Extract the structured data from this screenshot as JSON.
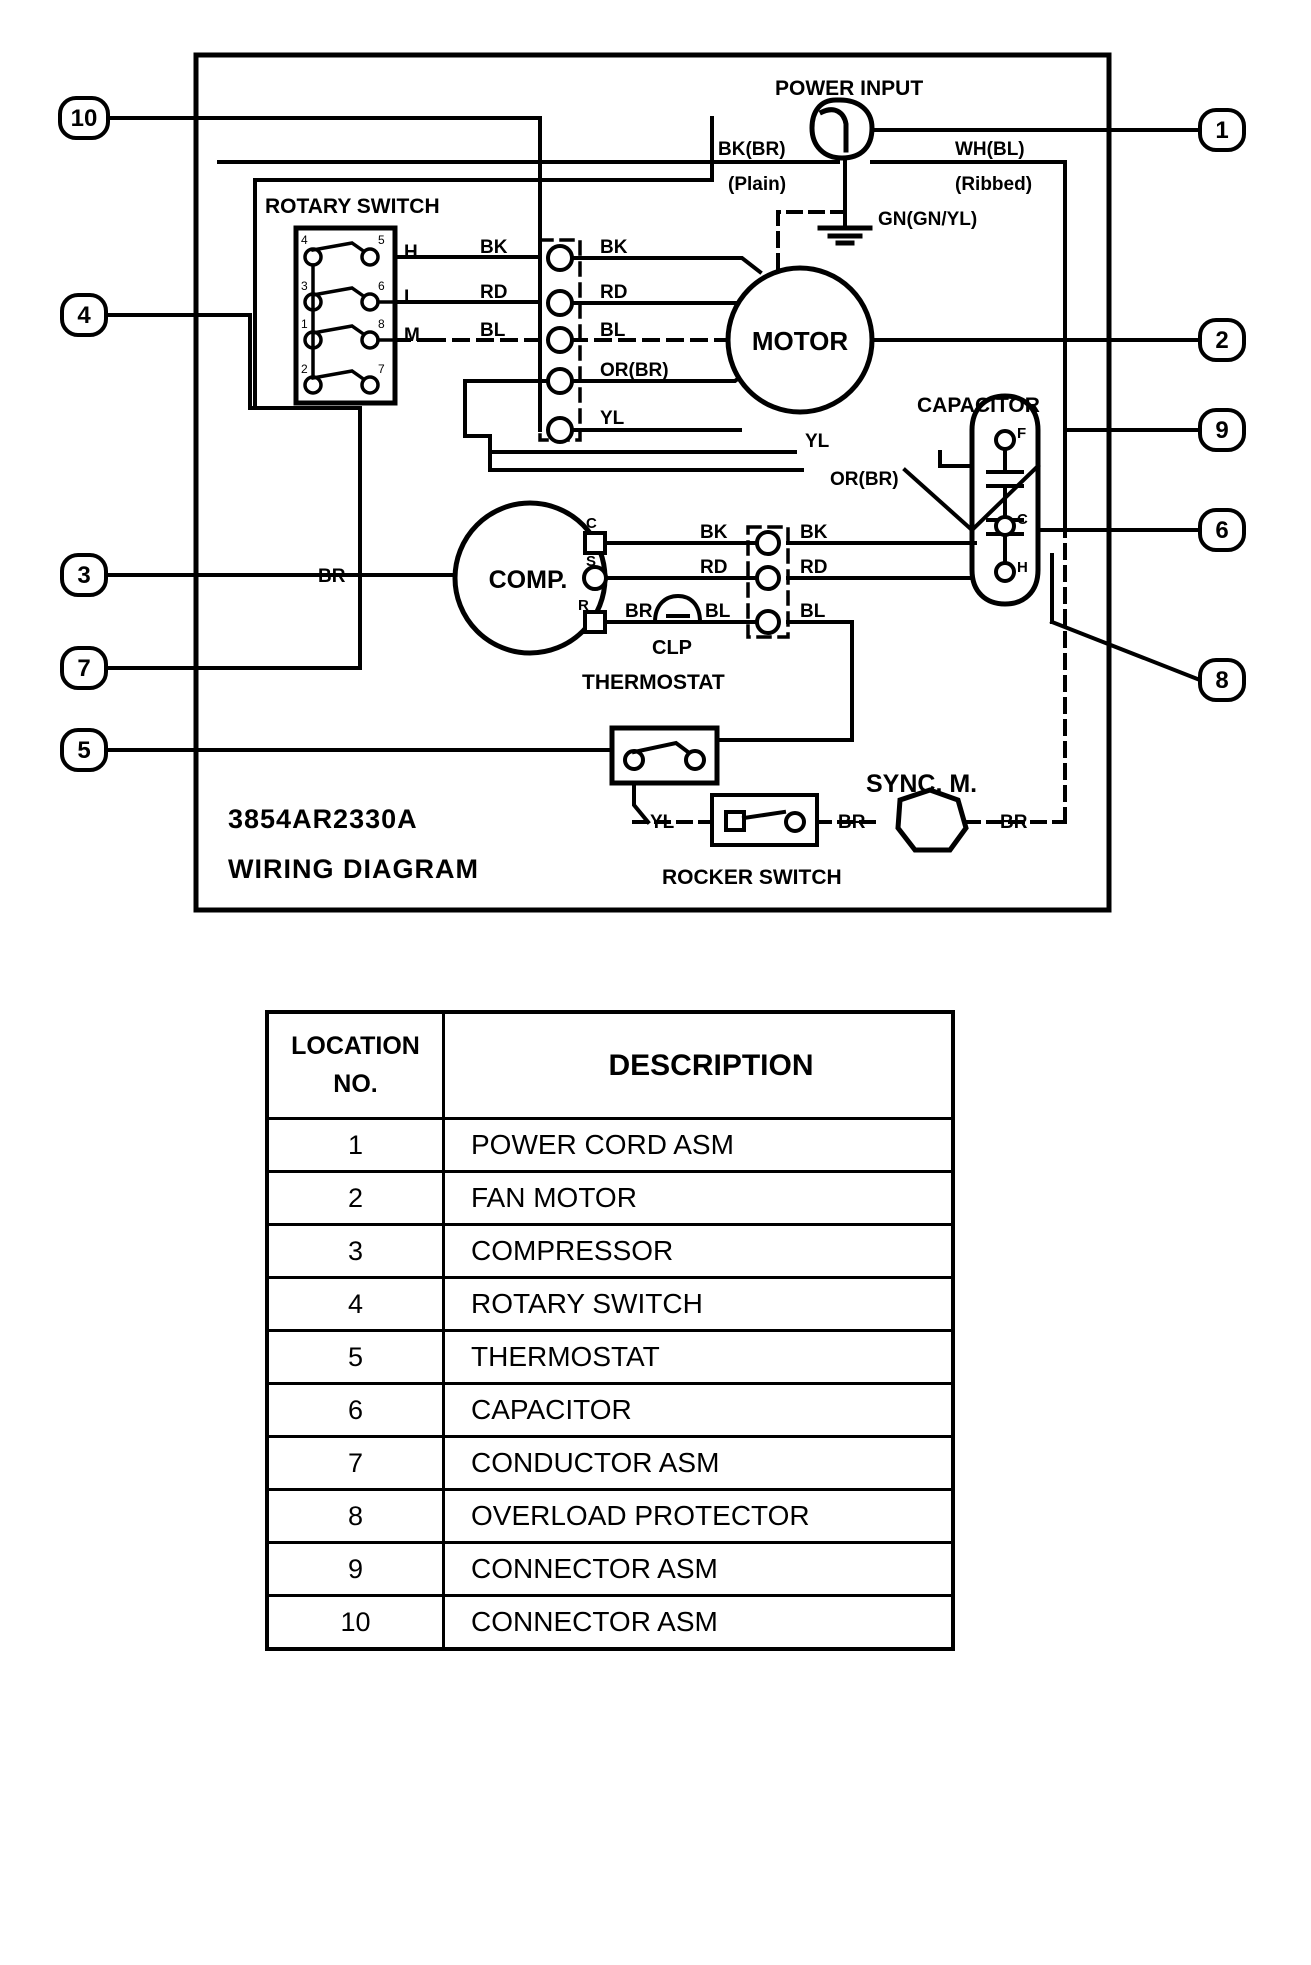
{
  "diagram": {
    "title_lines": [
      "3854AR2330A",
      "WIRING DIAGRAM"
    ],
    "blocks": {
      "power_input": "POWER INPUT",
      "rotary_switch": "ROTARY SWITCH",
      "motor": "MOTOR",
      "comp": "COMP.",
      "capacitor": "CAPACITOR",
      "thermostat": "THERMOSTAT",
      "rocker_switch": "ROCKER SWITCH",
      "sync_motor": "SYNC. M.",
      "clp": "CLP"
    },
    "wire_labels": {
      "line_bk": "BK(BR)",
      "line_bk_sub": "(Plain)",
      "line_wh": "WH(BL)",
      "line_wh_sub": "(Ribbed)",
      "ground": "GN(GN/YL)",
      "sw_h": "H",
      "sw_l": "L",
      "sw_m": "M",
      "sw_bk": "BK",
      "sw_rd": "RD",
      "sw_bl": "BL",
      "conn_bk": "BK",
      "conn_rd": "RD",
      "conn_bl": "BL",
      "conn_or": "OR(BR)",
      "conn_yl": "YL",
      "cap_yl": "YL",
      "cap_or": "OR(BR)",
      "comp_bk": "BK",
      "comp_rd": "RD",
      "comp_br": "BR",
      "comp_bl": "BL",
      "comp_bk2": "BK",
      "comp_rd2": "RD",
      "comp_bl2": "BL",
      "br_left": "BR",
      "thermo_yl": "YL",
      "sync_br_left": "BR",
      "sync_br_right": "BR",
      "comp_c": "C",
      "comp_s": "S",
      "comp_r": "R",
      "cap_f": "F",
      "cap_c": "C",
      "cap_h": "H"
    },
    "callouts": [
      "10",
      "1",
      "4",
      "2",
      "9",
      "3",
      "6",
      "7",
      "8",
      "5"
    ],
    "switch_contacts": [
      "4",
      "5",
      "3",
      "6",
      "1",
      "8",
      "2",
      "7"
    ]
  },
  "legend": {
    "headers": {
      "col1_line1": "LOCATION",
      "col1_line2": "NO.",
      "col2": "DESCRIPTION"
    },
    "rows": [
      {
        "no": "1",
        "description": "POWER CORD ASM"
      },
      {
        "no": "2",
        "description": "FAN MOTOR"
      },
      {
        "no": "3",
        "description": "COMPRESSOR"
      },
      {
        "no": "4",
        "description": "ROTARY SWITCH"
      },
      {
        "no": "5",
        "description": "THERMOSTAT"
      },
      {
        "no": "6",
        "description": "CAPACITOR"
      },
      {
        "no": "7",
        "description": "CONDUCTOR ASM"
      },
      {
        "no": "8",
        "description": "OVERLOAD PROTECTOR"
      },
      {
        "no": "9",
        "description": "CONNECTOR ASM"
      },
      {
        "no": "10",
        "description": "CONNECTOR ASM"
      }
    ]
  },
  "colors": {
    "ink": "#000000",
    "paper": "#ffffff"
  }
}
